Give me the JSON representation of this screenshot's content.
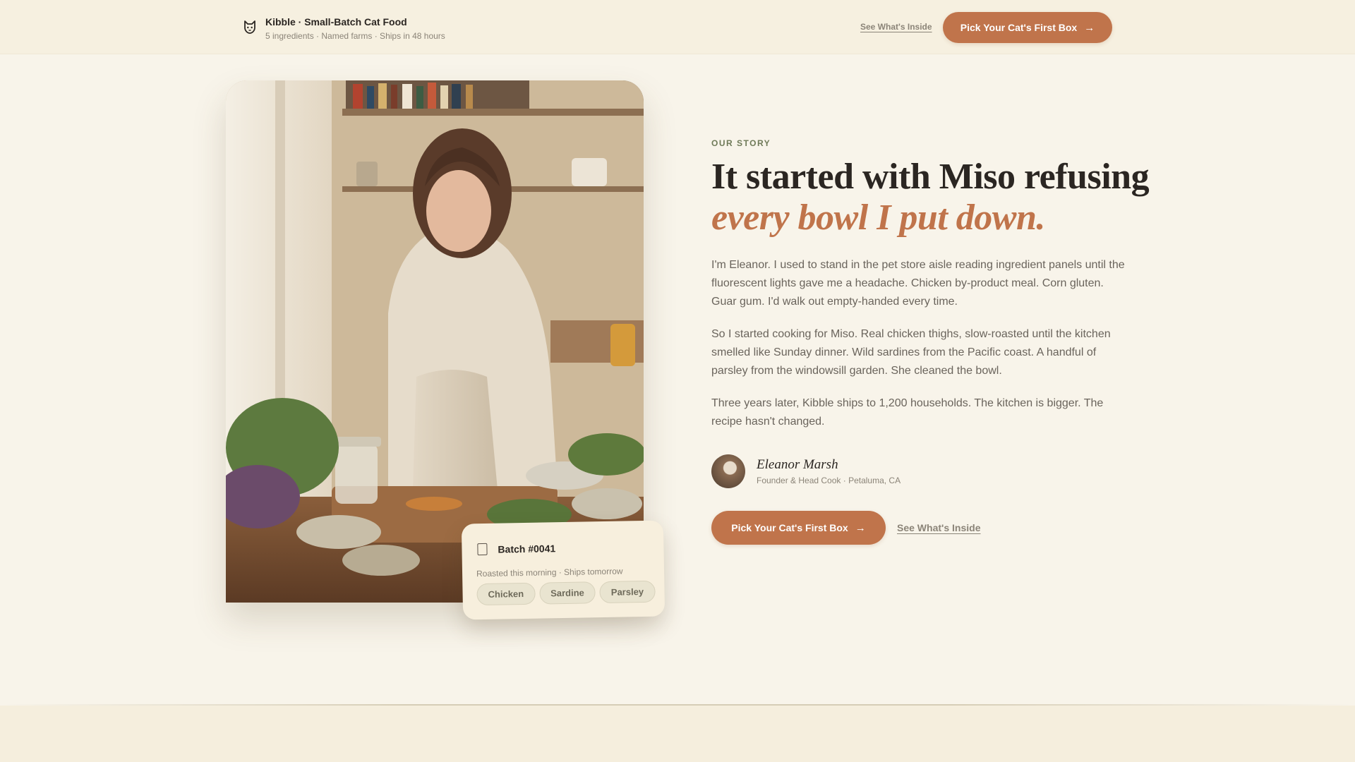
{
  "header": {
    "brand_title": "Kibble · Small-Batch Cat Food",
    "brand_subtitle": "5 ingredients · Named farms · Ships in 48 hours",
    "nav_link": "See What's Inside",
    "cta_label": "Pick Your Cat's First Box",
    "cta_arrow": "→",
    "logo_icon": "cat-face-icon"
  },
  "batch_card": {
    "icon": "jar-icon",
    "title": "Batch #0041",
    "subtitle": "Roasted this morning · Ships tomorrow",
    "chips": [
      "Chicken",
      "Sardine",
      "Parsley"
    ]
  },
  "story": {
    "eyebrow": "OUR STORY",
    "headline_line1": "It started with Miso refusing",
    "headline_line2": "every bowl I put down.",
    "paragraphs": [
      "I'm Eleanor. I used to stand in the pet store aisle reading ingredient panels until the fluorescent lights gave me a headache. Chicken by-product meal. Corn gluten. Guar gum. I'd walk out empty-handed every time.",
      "So I started cooking for Miso. Real chicken thighs, slow-roasted until the kitchen smelled like Sunday dinner. Wild sardines from the Pacific coast. A handful of parsley from the windowsill garden. She cleaned the bowl.",
      "Three years later, Kibble ships to 1,200 households. The kitchen is bigger. The recipe hasn't changed."
    ],
    "author_name": "Eleanor Marsh",
    "author_role": "Founder & Head Cook · Petaluma, CA",
    "cta_label": "Pick Your Cat's First Box",
    "cta_arrow": "→",
    "secondary_link": "See What's Inside"
  },
  "colors": {
    "accent": "#c0744b",
    "background": "#f8f4ea",
    "eyebrow": "#6f7a58"
  }
}
